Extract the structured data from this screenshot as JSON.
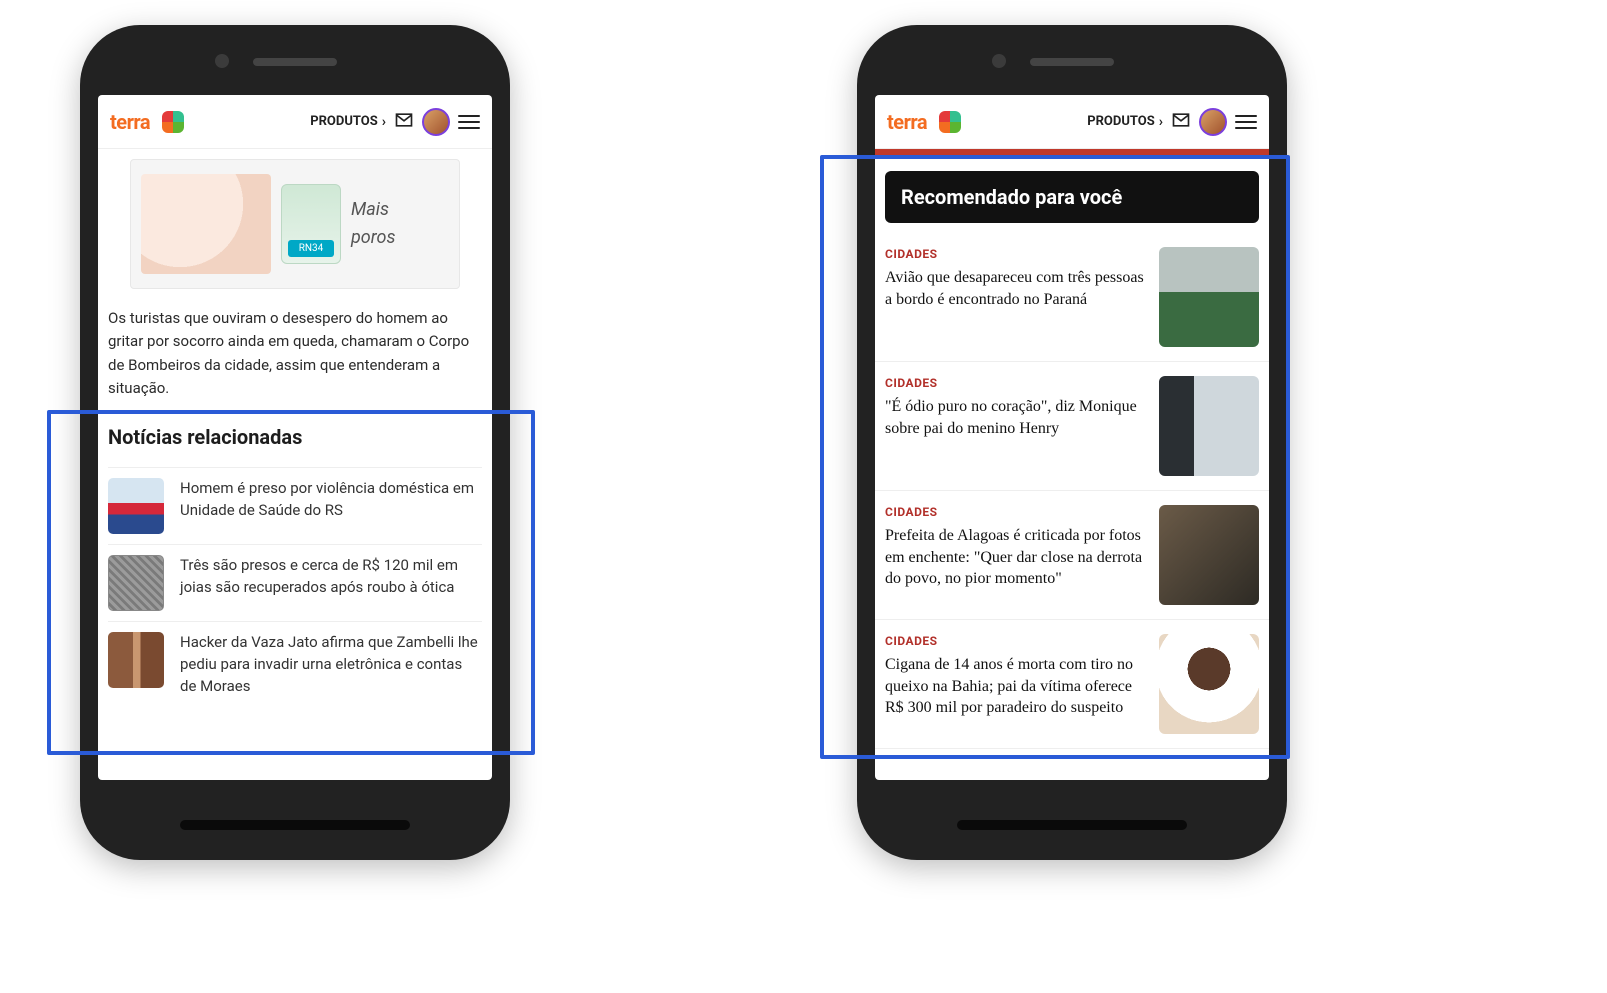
{
  "header": {
    "logo_text": "terra",
    "produtos_label": "PRODUTOS"
  },
  "left_phone": {
    "ad": {
      "tag": "RN34",
      "copy_line1": "Mais",
      "copy_line2": "poros"
    },
    "paragraph": "Os turistas que ouviram o desespero do homem ao gritar por socorro ainda em queda, chamaram o Corpo de Bombeiros da cidade, assim que entenderam a situação.",
    "related_title": "Notícias relacionadas",
    "related": [
      {
        "title": "Homem é preso por violência doméstica em Unidade de Saúde do RS"
      },
      {
        "title": "Três são presos e cerca de R$ 120 mil em joias são recuperados após roubo à ótica"
      },
      {
        "title": "Hacker da Vaza Jato afirma que Zambelli lhe pediu para invadir urna eletrônica e contas de Moraes"
      }
    ]
  },
  "right_phone": {
    "section_title": "Recomendado para você",
    "category_label": "CIDADES",
    "items": [
      {
        "title": "Avião que desapareceu com três pessoas a bordo é encontrado no Paraná"
      },
      {
        "title": "\"É ódio puro no coração\", diz Monique sobre pai do menino Henry"
      },
      {
        "title": "Prefeita de Alagoas é criticada por fotos em enchente: \"Quer dar close na derrota do povo, no pior momento\""
      },
      {
        "title": "Cigana de 14 anos é morta com tiro no queixo na Bahia; pai da vítima oferece R$ 300 mil por paradeiro do suspeito"
      }
    ]
  }
}
